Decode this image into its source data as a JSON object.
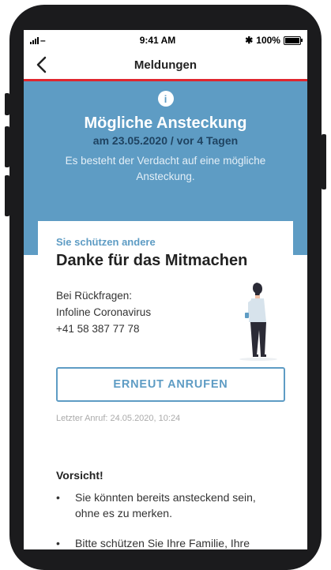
{
  "status_bar": {
    "time": "9:41 AM",
    "battery": "100%",
    "signal_suffix": "–"
  },
  "nav": {
    "title": "Meldungen"
  },
  "hero": {
    "title": "Mögliche Ansteckung",
    "date": "am 23.05.2020 / vor 4 Tagen",
    "description": "Es besteht der Verdacht auf eine mögliche Ansteckung."
  },
  "card": {
    "eyebrow": "Sie schützen andere",
    "heading": "Danke für das Mitmachen",
    "contact": [
      "Bei Rückfragen:",
      "Infoline Coronavirus",
      "+41 58 387 77 78"
    ],
    "call_button": "ERNEUT ANRUFEN",
    "last_call": "Letzter Anruf: 24.05.2020, 10:24",
    "warning_title": "Vorsicht!",
    "bullets": [
      "Sie könnten bereits ansteckend sein, ohne es zu merken.",
      "Bitte schützen Sie Ihre Familie, Ihre"
    ]
  },
  "colors": {
    "accent": "#5e9cc4",
    "brand_red": "#e0262e",
    "dark_blue": "#1f4361"
  }
}
